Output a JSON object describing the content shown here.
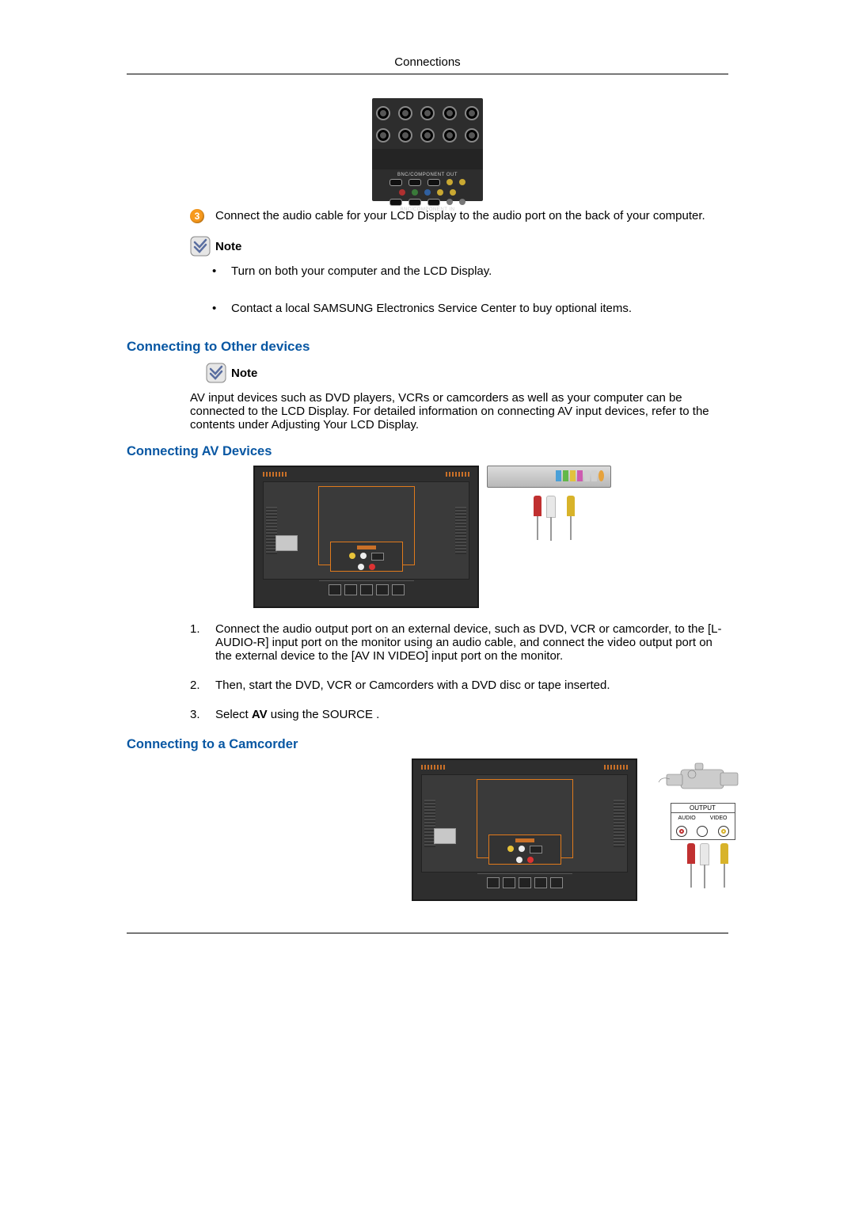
{
  "header": {
    "title": "Connections"
  },
  "port_panel": {
    "out_label": "BNC/COMPONENT OUT",
    "in_label": "BNC/COMPONENT IN"
  },
  "step3": {
    "number": "3",
    "text": "Connect the audio cable for your LCD Display to the audio port on the back of your computer."
  },
  "note1": {
    "label": "Note",
    "bullets": [
      "Turn on both your computer and the LCD Display.",
      "Contact a local SAMSUNG Electronics Service Center to buy optional items."
    ]
  },
  "section_other": {
    "heading": "Connecting to Other devices",
    "note_label": "Note",
    "paragraph": "AV input devices such as DVD players, VCRs or camcorders as well as your computer can be connected to the LCD Display. For detailed information on connecting AV input devices, refer to the contents under Adjusting Your LCD Display."
  },
  "section_av": {
    "heading": "Connecting AV Devices",
    "steps": [
      "Connect the audio output port on an external device, such as DVD, VCR or camcorder, to the [L-AUDIO-R] input port on the monitor using an audio cable, and connect the video output port on the external device to the [AV IN VIDEO] input port on the monitor.",
      "Then, start the DVD, VCR or Camcorders with a DVD disc or tape inserted."
    ],
    "step3_prefix": "Select ",
    "step3_bold": "AV",
    "step3_suffix": " using the SOURCE ."
  },
  "section_camcorder": {
    "heading": "Connecting to a Camcorder",
    "output_label": "OUTPUT",
    "audio_label": "AUDIO",
    "video_label": "VIDEO"
  }
}
